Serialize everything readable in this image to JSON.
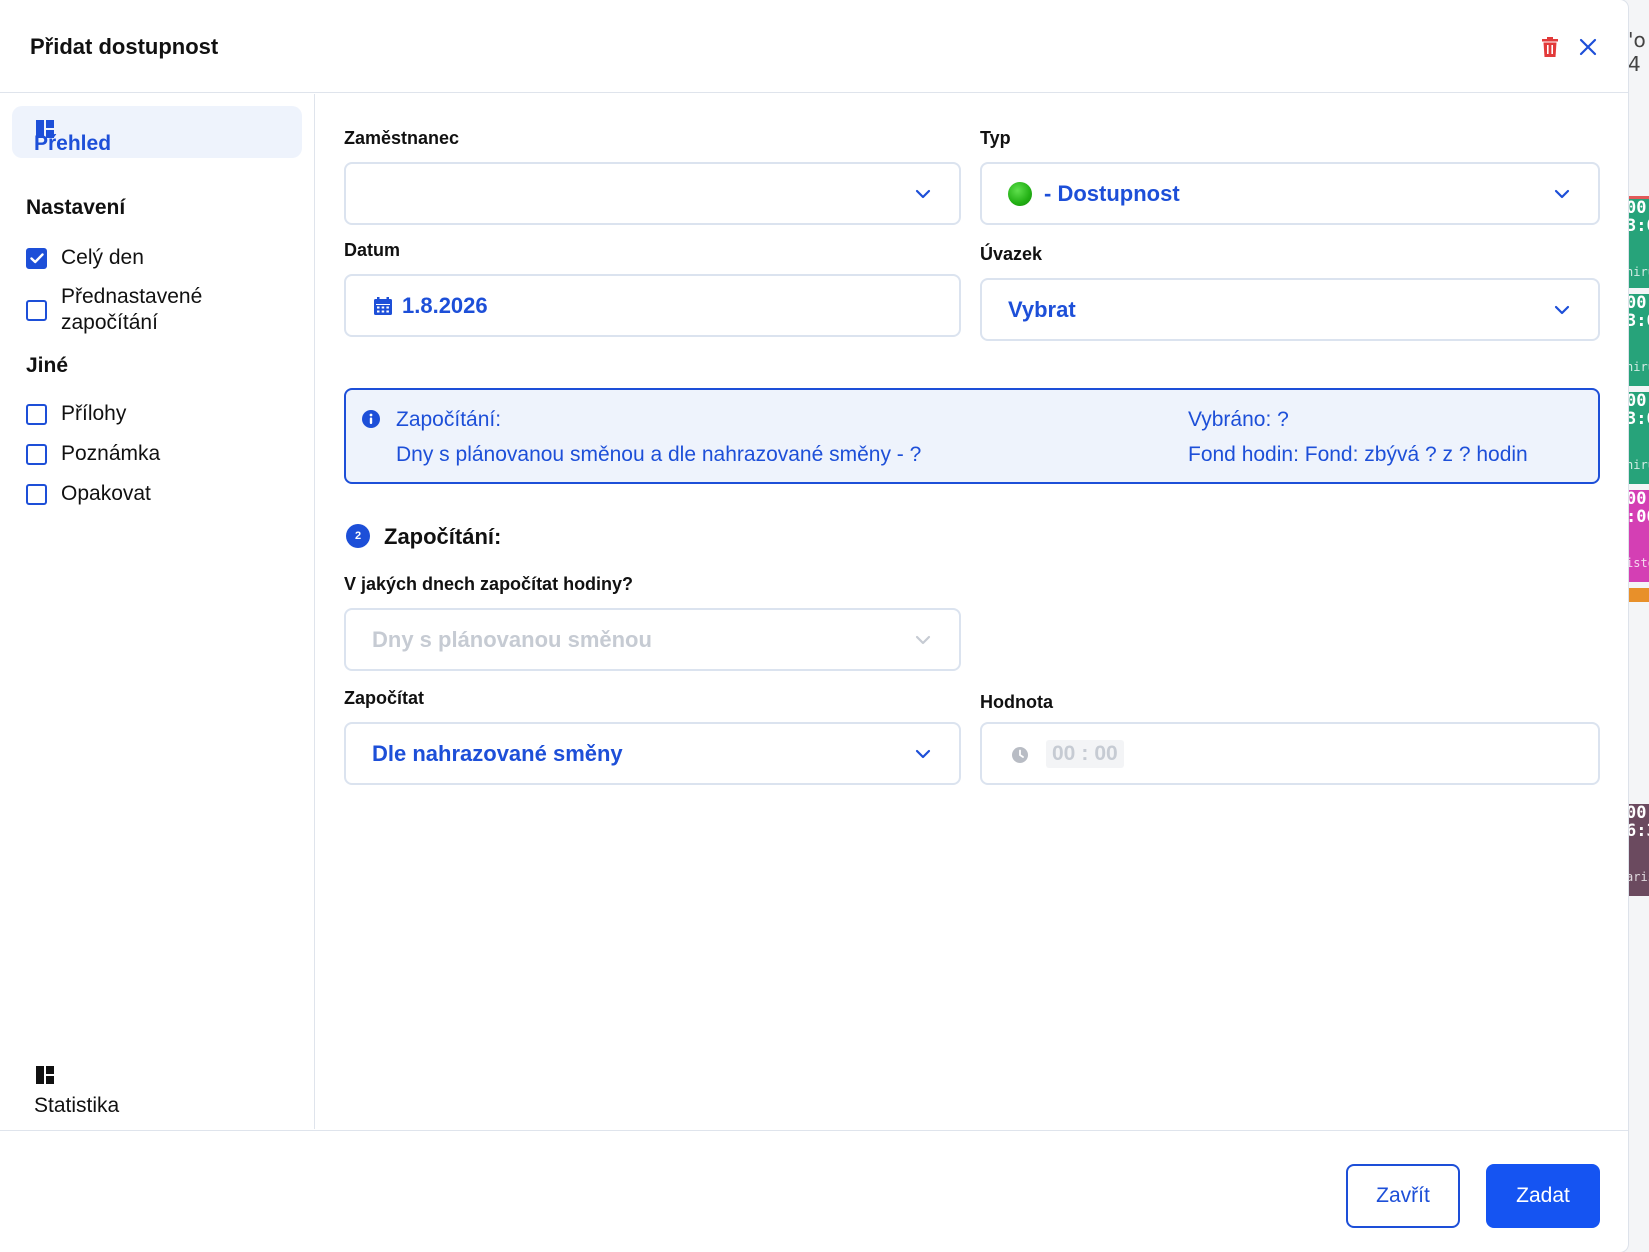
{
  "dialog": {
    "title": "Přidat dostupnost"
  },
  "sidebar": {
    "active_item": "Přehled",
    "sections": {
      "settings_title": "Nastavení",
      "other_title": "Jiné"
    },
    "settings": [
      {
        "label": "Celý den",
        "checked": true
      },
      {
        "label": "Přednastavené započítání",
        "checked": false
      }
    ],
    "other": [
      {
        "label": "Přílohy",
        "checked": false
      },
      {
        "label": "Poznámka",
        "checked": false
      },
      {
        "label": "Opakovat",
        "checked": false
      }
    ],
    "bottom_item": "Statistika"
  },
  "form": {
    "employee": {
      "label": "Zaměstnanec",
      "value": ""
    },
    "type": {
      "label": "Typ",
      "value": "- Dostupnost",
      "dot_color": "#22b014"
    },
    "date": {
      "label": "Datum",
      "value": "1.8.2026"
    },
    "workload": {
      "label": "Úvazek",
      "value": "Vybrat"
    },
    "info": {
      "title": "Započítání:",
      "detail": "Dny s plánovanou směnou a dle nahrazované směny - ?",
      "selected": "Vybráno: ?",
      "fund": "Fond hodin: Fond: zbývá ? z ? hodin"
    },
    "section_step": "2",
    "section_title": "Započítání:",
    "days_question": {
      "label": "V jakých dnech započítat hodiny?",
      "value": "Dny s plánovanou směnou"
    },
    "count": {
      "label": "Započítat",
      "value": "Dle nahrazované směny"
    },
    "amount": {
      "label": "Hodnota",
      "hours": "00",
      "separator": ":",
      "minutes": "00"
    }
  },
  "footer": {
    "close_label": "Zavřít",
    "submit_label": "Zadat"
  },
  "background": {
    "header_chars": "'o\n4",
    "blocks": [
      {
        "color": "#27a37a",
        "time": "00\n3:0",
        "note": "hiru"
      },
      {
        "color": "#27a37a",
        "time": "00\n3:0",
        "note": "hiru"
      },
      {
        "color": "#27a37a",
        "time": "00\n3:0",
        "note": "hiru"
      },
      {
        "color": "#d43fb4",
        "time": "00\n:00",
        "note": "isto"
      },
      {
        "color": "#6b4a5f",
        "time": "00\n6:3",
        "note": "aris"
      }
    ]
  },
  "colors": {
    "accent": "#1d4fd8",
    "primary_button": "#1554f2",
    "delete_icon": "#e23a3a"
  }
}
